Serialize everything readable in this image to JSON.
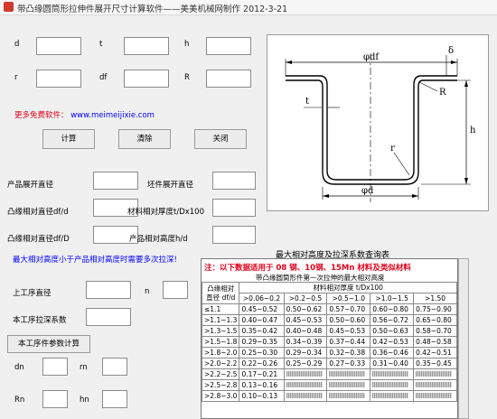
{
  "window": {
    "title": "带凸缘圆筒形拉伸件展开尺寸计算软件——美美机械网制作   2012-3-21"
  },
  "inputs_top": {
    "d": "d",
    "t": "t",
    "h": "h",
    "r": "r",
    "df": "df",
    "R": "R"
  },
  "promo": {
    "label": "更多免费软件：",
    "url": "www.meimeijixie.com"
  },
  "buttons": {
    "calc": "计算",
    "clear": "清除",
    "close": "关闭",
    "calc_current": "本工序件参数计算"
  },
  "results": {
    "product_diameter": "产品展开直径",
    "blank_diameter": "坯件展开直径",
    "flange_ratio": "凸缘相对直径df/d",
    "thickness_ratio": "材料相对厚度t/Dx100",
    "flange_ratio_D": "凸缘相对直径df/D",
    "height_ratio": "产品相对高度h/d"
  },
  "warning": "最大相对高度小于产品相对高度时需要多次拉深!",
  "process": {
    "current_diameter": "上工序直径",
    "n": "n",
    "coefficient": "本工序拉深系数",
    "dn": "dn",
    "rn": "rn",
    "Rn": "Rn",
    "hn": "hn"
  },
  "drawing_labels": {
    "df": "φdf",
    "delta": "δ",
    "d": "φd",
    "R": "R",
    "t": "t",
    "r": "r",
    "h": "h"
  },
  "table": {
    "title": "最大相对高度及拉深系数查询表",
    "note": "注：以下数据适用于 08 钢、10钢、15Mn 材料及类似材料",
    "subtitle": "带凸缘圆筒形件第一次拉伸的最大相对高度",
    "header_left": "凸缘相对直径 df/d",
    "header_group": "材料相对厚度 t/Dx100",
    "columns": [
      ">0.06~0.2",
      ">0.2~0.5",
      ">0.5~1.0",
      ">1.0~1.5",
      ">1.50"
    ],
    "rows": [
      {
        "k": "≤1.1",
        "v": [
          "0.45~0.52",
          "0.50~0.62",
          "0.57~0.70",
          "0.60~0.80",
          "0.75~0.90"
        ]
      },
      {
        "k": ">1.1~1.3",
        "v": [
          "0.40~0.47",
          "0.45~0.53",
          "0.50~0.60",
          "0.56~0.72",
          "0.65~0.80"
        ]
      },
      {
        "k": ">1.3~1.5",
        "v": [
          "0.35~0.42",
          "0.40~0.48",
          "0.45~0.53",
          "0.50~0.63",
          "0.58~0.70"
        ]
      },
      {
        "k": ">1.5~1.8",
        "v": [
          "0.29~0.35",
          "0.34~0.39",
          "0.37~0.44",
          "0.42~0.53",
          "0.48~0.58"
        ]
      },
      {
        "k": ">1.8~2.0",
        "v": [
          "0.25~0.30",
          "0.29~0.34",
          "0.32~0.38",
          "0.36~0.46",
          "0.42~0.51"
        ]
      },
      {
        "k": ">2.0~2.2",
        "v": [
          "0.22~0.26",
          "0.25~0.29",
          "0.27~0.33",
          "0.31~0.40",
          "0.35~0.45"
        ]
      },
      {
        "k": ">2.2~2.5",
        "v": [
          "0.17~0.21",
          "",
          "",
          "",
          ""
        ]
      },
      {
        "k": ">2.5~2.8",
        "v": [
          "0.13~0.16",
          "",
          "",
          "",
          ""
        ]
      },
      {
        "k": ">2.8~3.0",
        "v": [
          "0.10~0.13",
          "",
          "",
          "",
          ""
        ]
      }
    ]
  }
}
